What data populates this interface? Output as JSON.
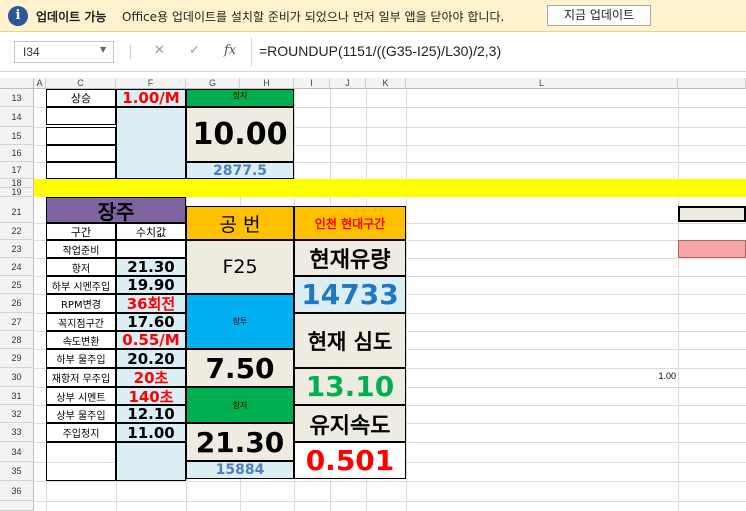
{
  "update_bar": {
    "icon": "info-icon",
    "title": "업데이트 가능",
    "message": "Office용 업데이트를 설치할 준비가 되었으나 먼저 일부 앱을 닫아야 합니다.",
    "button": "지금 업데이트"
  },
  "formula_bar": {
    "name_box": "I34",
    "cancel": "✕",
    "enter": "✓",
    "fx": "fx",
    "formula": "=ROUNDUP(1151/((G35-I25)/L30)/2,3)"
  },
  "columns": [
    "A",
    "C",
    "F",
    "G",
    "H",
    "I",
    "J",
    "K",
    "L"
  ],
  "rows": [
    "13",
    "14",
    "15",
    "16",
    "17",
    "18",
    "19",
    "21",
    "22",
    "23",
    "24",
    "25",
    "26",
    "27",
    "28",
    "29",
    "30",
    "31",
    "32",
    "33",
    "34",
    "35",
    "36"
  ],
  "top_section": {
    "c13": "상승",
    "f13": "1.00/M",
    "g13": "정지",
    "big_value": "10.00",
    "g17": "2877.5"
  },
  "left_table": {
    "title": "장주",
    "headers": [
      "구간",
      "수치값"
    ],
    "items": [
      {
        "label": "작업준비",
        "value": ""
      },
      {
        "label": "항저",
        "value": "21.30"
      },
      {
        "label": "하부 시멘주입",
        "value": "19.90"
      },
      {
        "label": "RPM변경",
        "value": "36회전"
      },
      {
        "label": "꼭지점구간",
        "value": "17.60"
      },
      {
        "label": "속도변환",
        "value": "0.55/M"
      },
      {
        "label": "하부 물주입",
        "value": "20.20"
      },
      {
        "label": "재항저 무주입",
        "value": "20초"
      },
      {
        "label": "상부 시멘트",
        "value": "140초"
      },
      {
        "label": "상부 물주입",
        "value": "12.10"
      },
      {
        "label": "주입정지",
        "value": "11.00"
      }
    ]
  },
  "middle": {
    "header": "공 번",
    "pile": "F25",
    "status1": "항투",
    "value1": "7.50",
    "status2": "항저",
    "value2": "21.30",
    "sub": "15884"
  },
  "right": {
    "header": "인천 현대구간",
    "label1": "현재유량",
    "value1": "14733",
    "label2": "현재 심도",
    "value2": "13.10",
    "label3": "유지속도",
    "value3": "0.501"
  },
  "l30": "1.00",
  "colors": {
    "yellow_band": "#ffff00",
    "green": "#00b050",
    "skyblue": "#00b0f0",
    "orange": "#ffc000",
    "purple": "#8064a2",
    "red": "#ff0000",
    "blue": "#1f78c1"
  }
}
